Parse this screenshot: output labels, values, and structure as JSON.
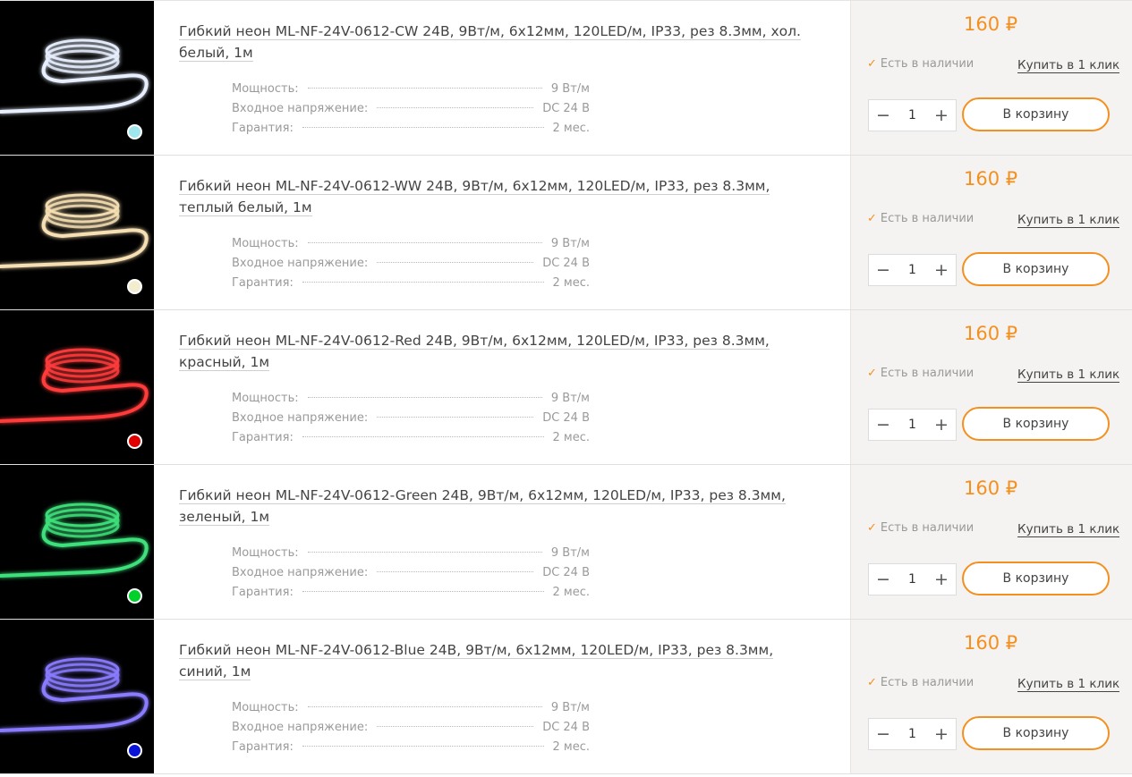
{
  "products": [
    {
      "title": "Гибкий неон ML-NF-24V-0612-CW 24В, 9Вт/м, 6х12мм, 120LED/м, IP33, рез 8.3мм, хол. белый, 1м",
      "glow_color": "#e8f0ff",
      "swatch_color": "#9fe6ee",
      "specs": [
        {
          "label": "Мощность:",
          "value": "9 Вт/м"
        },
        {
          "label": "Входное напряжение:",
          "value": "DC 24 В"
        },
        {
          "label": "Гарантия:",
          "value": "2 мес."
        }
      ],
      "price": "160 ₽",
      "stock": "Есть в наличии",
      "one_click": "Купить в 1 клик",
      "quantity": "1",
      "cart_label": "В корзину"
    },
    {
      "title": "Гибкий неон ML-NF-24V-0612-WW 24В, 9Вт/м, 6х12мм, 120LED/м, IP33, рез 8.3мм, теплый белый, 1м",
      "glow_color": "#f6dfb3",
      "swatch_color": "#f3edd0",
      "specs": [
        {
          "label": "Мощность:",
          "value": "9 Вт/м"
        },
        {
          "label": "Входное напряжение:",
          "value": "DC 24 В"
        },
        {
          "label": "Гарантия:",
          "value": "2 мес."
        }
      ],
      "price": "160 ₽",
      "stock": "Есть в наличии",
      "one_click": "Купить в 1 клик",
      "quantity": "1",
      "cart_label": "В корзину"
    },
    {
      "title": "Гибкий неон ML-NF-24V-0612-Red 24В, 9Вт/м, 6х12мм, 120LED/м, IP33, рез 8.3мм, красный, 1м",
      "glow_color": "#ff3b3b",
      "swatch_color": "#e00000",
      "specs": [
        {
          "label": "Мощность:",
          "value": "9 Вт/м"
        },
        {
          "label": "Входное напряжение:",
          "value": "DC 24 В"
        },
        {
          "label": "Гарантия:",
          "value": "2 мес."
        }
      ],
      "price": "160 ₽",
      "stock": "Есть в наличии",
      "one_click": "Купить в 1 клик",
      "quantity": "1",
      "cart_label": "В корзину"
    },
    {
      "title": "Гибкий неон ML-NF-24V-0612-Green 24В, 9Вт/м, 6х12мм, 120LED/м, IP33, рез 8.3мм, зеленый, 1м",
      "glow_color": "#3ee07a",
      "swatch_color": "#00d12a",
      "specs": [
        {
          "label": "Мощность:",
          "value": "9 Вт/м"
        },
        {
          "label": "Входное напряжение:",
          "value": "DC 24 В"
        },
        {
          "label": "Гарантия:",
          "value": "2 мес."
        }
      ],
      "price": "160 ₽",
      "stock": "Есть в наличии",
      "one_click": "Купить в 1 клик",
      "quantity": "1",
      "cart_label": "В корзину"
    },
    {
      "title": "Гибкий неон ML-NF-24V-0612-Blue 24В, 9Вт/м, 6х12мм, 120LED/м, IP33, рез 8.3мм, синий, 1м",
      "glow_color": "#8a7bff",
      "swatch_color": "#0a14d6",
      "specs": [
        {
          "label": "Мощность:",
          "value": "9 Вт/м"
        },
        {
          "label": "Входное напряжение:",
          "value": "DC 24 В"
        },
        {
          "label": "Гарантия:",
          "value": "2 мес."
        }
      ],
      "price": "160 ₽",
      "stock": "Есть в наличии",
      "one_click": "Купить в 1 клик",
      "quantity": "1",
      "cart_label": "В корзину"
    }
  ],
  "icons": {
    "stock": "check-icon",
    "minus": "minus-icon",
    "plus": "plus-icon"
  },
  "colors": {
    "accent": "#f39020"
  }
}
